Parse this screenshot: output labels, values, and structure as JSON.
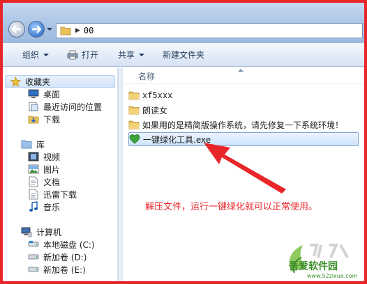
{
  "address": {
    "path": "00"
  },
  "toolbar": {
    "organize": "组织",
    "print": "打开",
    "share": "共享",
    "new_folder": "新建文件夹"
  },
  "nav": {
    "favorites": "收藏夹",
    "desktop": "桌面",
    "recent": "最近访问的位置",
    "downloads": "下载",
    "libraries": "库",
    "videos": "视频",
    "pictures": "图片",
    "documents": "文档",
    "xunlei": "迅雷下载",
    "music": "音乐",
    "computer": "计算机",
    "local_disk": "本地磁盘 (C:)",
    "new_vol_d": "新加卷 (D:)",
    "new_vol_e": "新加卷 (E:)"
  },
  "content": {
    "column_name": "名称",
    "files": [
      {
        "name": "xf5xxx",
        "type": "folder"
      },
      {
        "name": "朗读女",
        "type": "folder"
      },
      {
        "name": "如果用的是精简版操作系统，请先修复一下系统环境！",
        "type": "folder"
      },
      {
        "name": "一键绿化工具.exe",
        "type": "exe",
        "selected": true
      }
    ]
  },
  "annotation": {
    "text": "解压文件，运行一键绿化就可以正常使用。",
    "color": "#e8262a"
  },
  "watermark": {
    "brand": "吾爱软件园",
    "url": "www.52zixue.com"
  }
}
